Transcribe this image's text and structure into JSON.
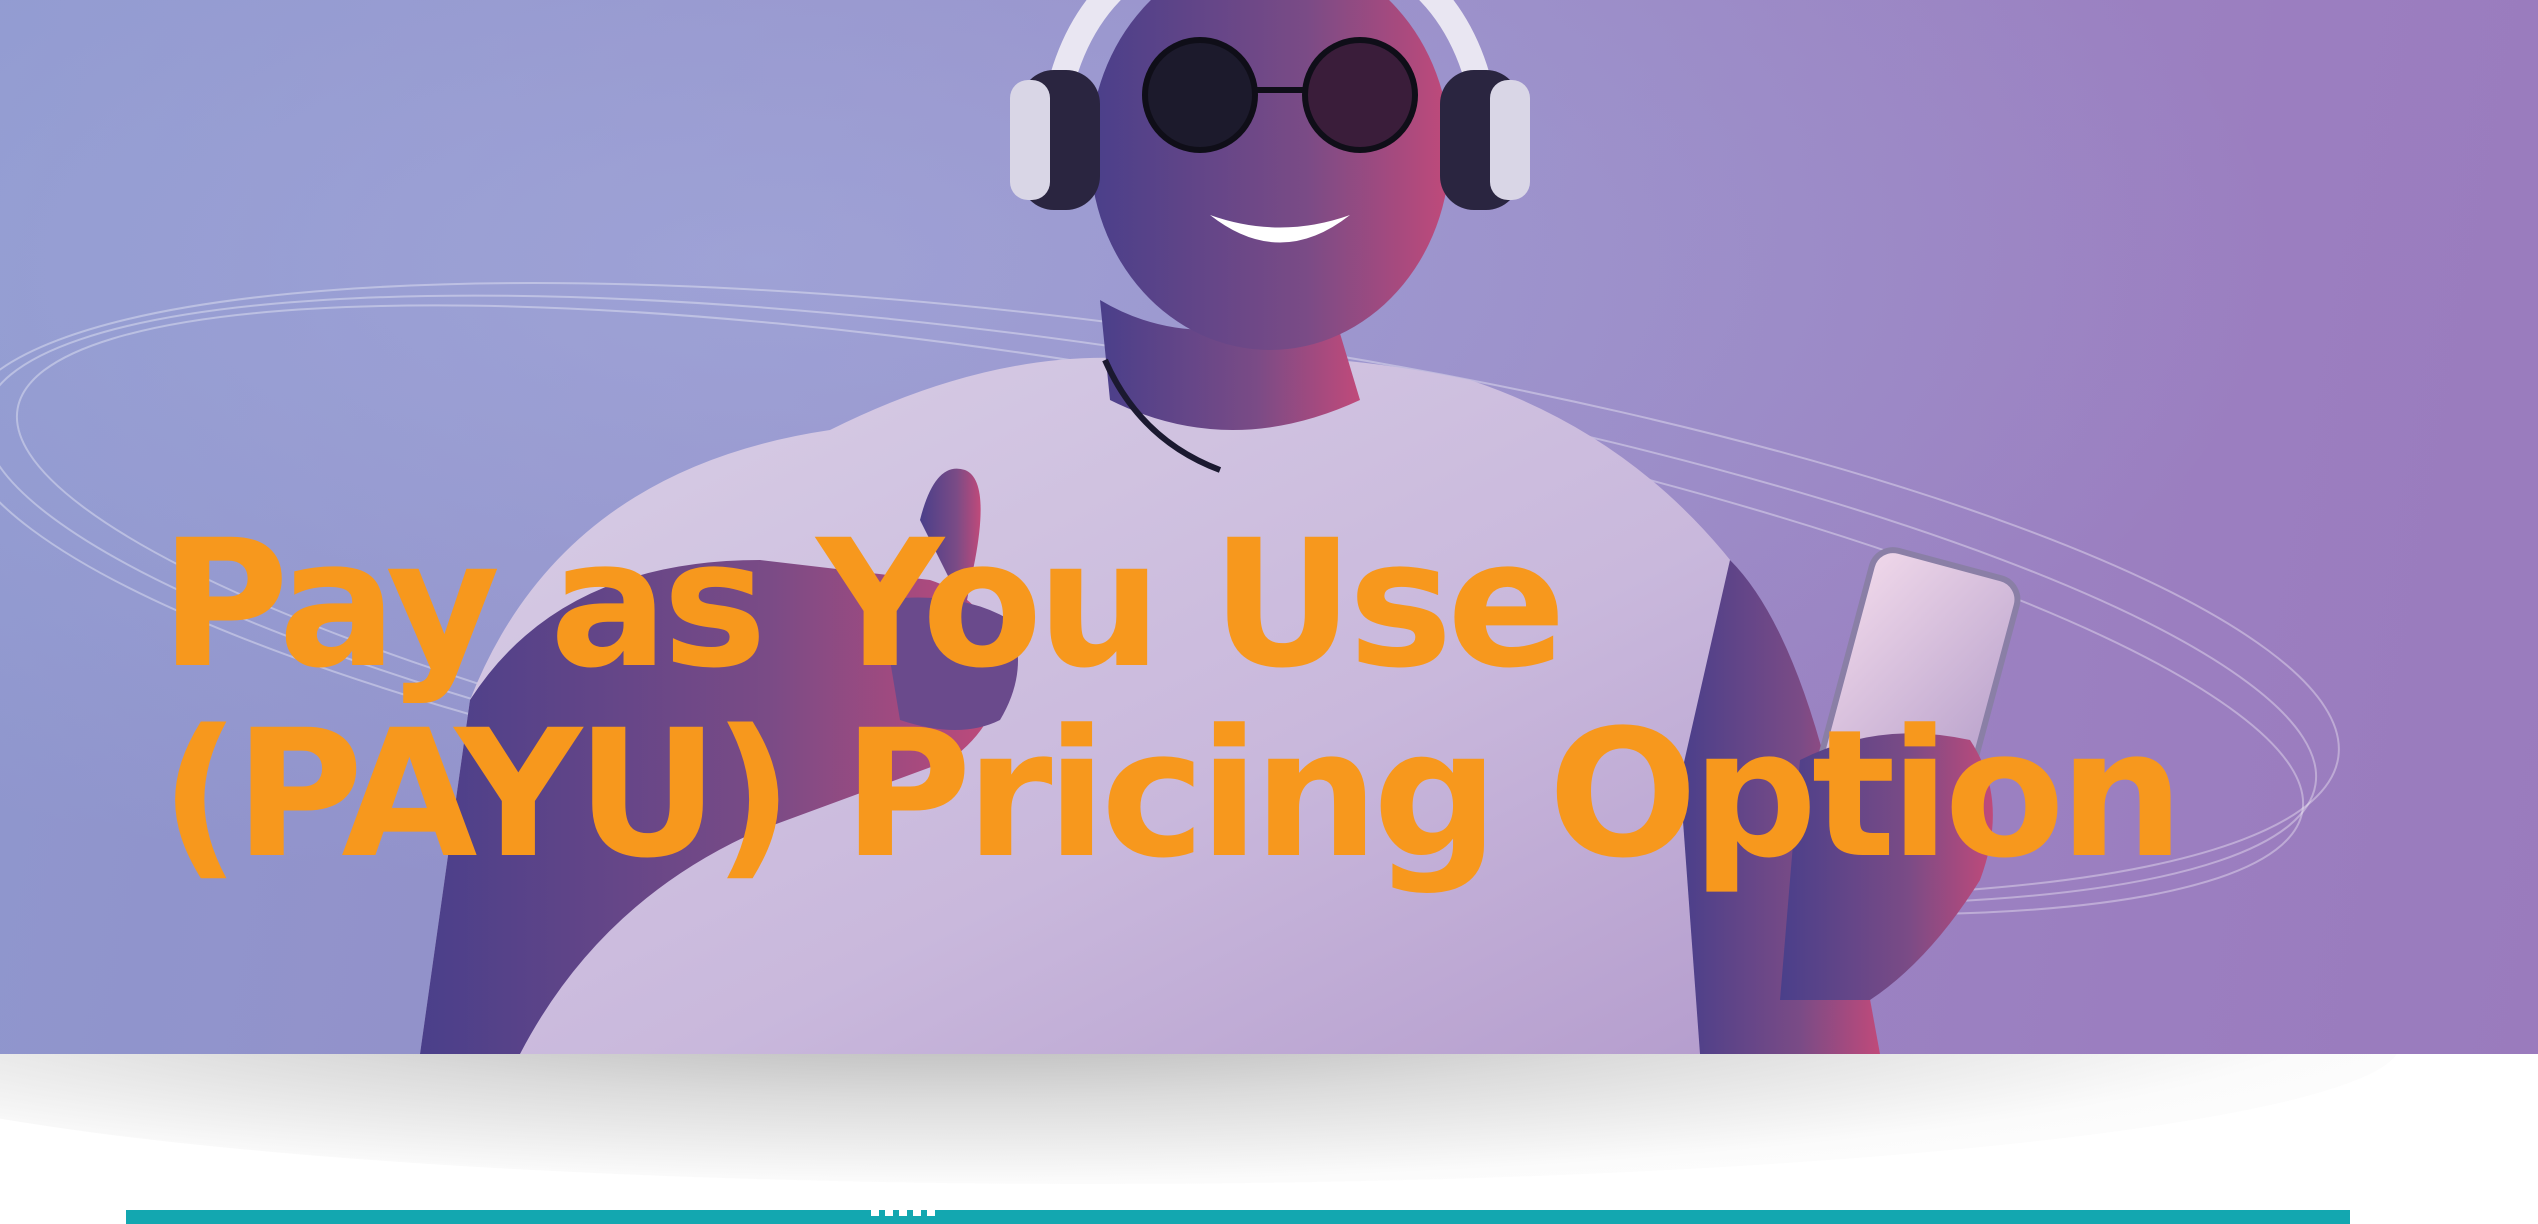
{
  "hero": {
    "headline_line1": "Pay as You Use",
    "headline_line2": "(PAYU) Pricing Option",
    "photo_icon": "person-with-headphones-and-phone-photo"
  },
  "colors": {
    "headline": "#f7981d",
    "hero_background": "#9a87c4",
    "bottom_bar": "#13a7b0"
  }
}
